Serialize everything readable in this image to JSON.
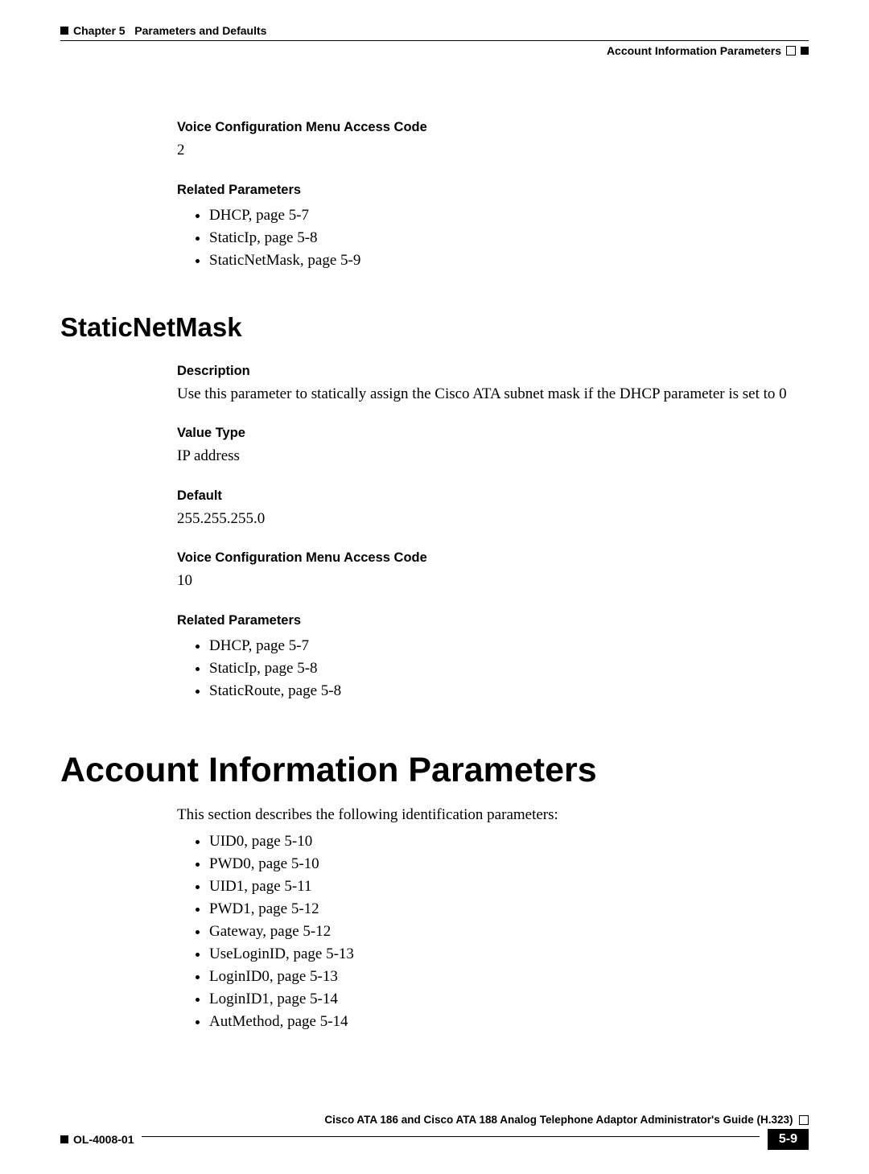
{
  "header": {
    "chapter": "Chapter 5",
    "title": "Parameters and Defaults",
    "section": "Account Information Parameters"
  },
  "section1": {
    "voice_code_label": "Voice Configuration Menu Access Code",
    "voice_code_value": "2",
    "related_label": "Related Parameters",
    "related": [
      "DHCP, page 5-7",
      "StaticIp, page 5-8",
      "StaticNetMask, page 5-9"
    ]
  },
  "staticnetmask": {
    "heading": "StaticNetMask",
    "desc_label": "Description",
    "desc_value": "Use this parameter to statically assign the Cisco ATA subnet mask if the DHCP parameter is set to 0",
    "value_type_label": "Value Type",
    "value_type_value": "IP address",
    "default_label": "Default",
    "default_value": "255.255.255.0",
    "voice_code_label": "Voice Configuration Menu Access Code",
    "voice_code_value": "10",
    "related_label": "Related Parameters",
    "related": [
      "DHCP, page 5-7",
      "StaticIp, page 5-8",
      "StaticRoute, page 5-8"
    ]
  },
  "account_info": {
    "heading": "Account Information Parameters",
    "intro": "This section describes the following identification parameters:",
    "items": [
      "UID0, page 5-10",
      "PWD0, page 5-10",
      "UID1, page 5-11",
      "PWD1, page 5-12",
      "Gateway, page 5-12",
      "UseLoginID, page 5-13",
      "LoginID0, page 5-13",
      "LoginID1, page 5-14",
      "AutMethod, page 5-14"
    ]
  },
  "footer": {
    "guide": "Cisco ATA 186 and Cisco ATA 188 Analog Telephone Adaptor Administrator's Guide (H.323)",
    "doc_id": "OL-4008-01",
    "page": "5-9"
  }
}
